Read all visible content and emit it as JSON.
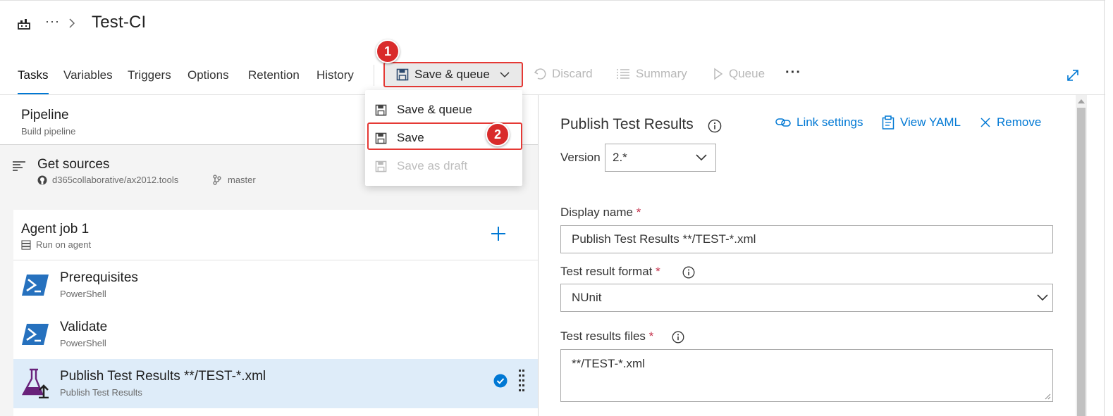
{
  "header": {
    "title": "Test-CI",
    "breadcrumb_more": "···",
    "breadcrumb_sep": ">"
  },
  "tabs": [
    {
      "label": "Tasks",
      "active": true
    },
    {
      "label": "Variables"
    },
    {
      "label": "Triggers"
    },
    {
      "label": "Options"
    },
    {
      "label": "Retention"
    },
    {
      "label": "History"
    }
  ],
  "toolbar": {
    "save_queue_label": "Save & queue",
    "discard_label": "Discard",
    "summary_label": "Summary",
    "queue_label": "Queue",
    "more_label": "···"
  },
  "badges": {
    "one": "1",
    "two": "2"
  },
  "save_menu": {
    "items": [
      {
        "label": "Save & queue",
        "enabled": true
      },
      {
        "label": "Save",
        "enabled": true,
        "highlighted": true
      },
      {
        "label": "Save as draft",
        "enabled": false
      }
    ]
  },
  "pipeline": {
    "title": "Pipeline",
    "subtitle": "Build pipeline"
  },
  "get_sources": {
    "title": "Get sources",
    "repo": "d365collaborative/ax2012.tools",
    "branch": "master"
  },
  "agent_job": {
    "title": "Agent job 1",
    "subtitle": "Run on agent"
  },
  "tasks": [
    {
      "title": "Prerequisites",
      "subtitle": "PowerShell",
      "icon": "powershell-icon"
    },
    {
      "title": "Validate",
      "subtitle": "PowerShell",
      "icon": "powershell-icon"
    },
    {
      "title": "Publish Test Results **/TEST-*.xml",
      "subtitle": "Publish Test Results",
      "icon": "flask-publish-icon",
      "selected": true
    }
  ],
  "details": {
    "title": "Publish Test Results",
    "link_settings": "Link settings",
    "view_yaml": "View YAML",
    "remove": "Remove",
    "version_label": "Version",
    "version_value": "2.*",
    "display_name_label": "Display name",
    "display_name_value": "Publish Test Results **/TEST-*.xml",
    "format_label": "Test result format",
    "format_value": "NUnit",
    "files_label": "Test results files",
    "files_value": "**/TEST-*.xml",
    "required_mark": "*"
  },
  "colors": {
    "accent": "#0078d4",
    "annotation_red": "#d92b2b",
    "selected_row": "#deecf9",
    "powershell_blue": "#2671be",
    "flask_purple": "#68217a"
  }
}
